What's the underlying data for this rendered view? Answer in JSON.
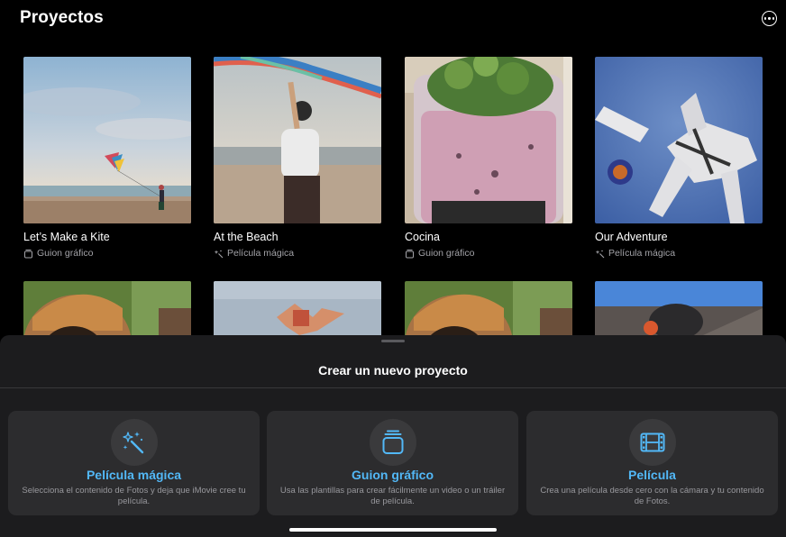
{
  "header": {
    "title": "Proyectos",
    "more_icon": "ellipsis-circle-icon"
  },
  "projects": [
    {
      "title": "Let’s Make a Kite",
      "type": "Guion gráfico",
      "type_icon": "storyboard-icon"
    },
    {
      "title": "At the Beach",
      "type": "Película mágica",
      "type_icon": "magic-sparkle-icon"
    },
    {
      "title": "Cocina",
      "type": "Guion gráfico",
      "type_icon": "storyboard-icon"
    },
    {
      "title": "Our Adventure",
      "type": "Película mágica",
      "type_icon": "magic-sparkle-icon"
    }
  ],
  "sheet": {
    "title": "Crear un nuevo proyecto",
    "options": [
      {
        "title": "Película mágica",
        "description": "Selecciona el contenido de Fotos y deja que iMovie cree tu película.",
        "icon": "magic-wand-icon"
      },
      {
        "title": "Guion gráfico",
        "description": "Usa las plantillas para crear fácilmente un video o un tráiler de película.",
        "icon": "storyboard-stack-icon"
      },
      {
        "title": "Película",
        "description": "Crea una película desde cero con la cámara y tu contenido de Fotos.",
        "icon": "film-icon"
      }
    ]
  },
  "colors": {
    "accent": "#52b8f7",
    "sheet_background": "#1c1c1e",
    "card_background": "#2c2c2e"
  }
}
